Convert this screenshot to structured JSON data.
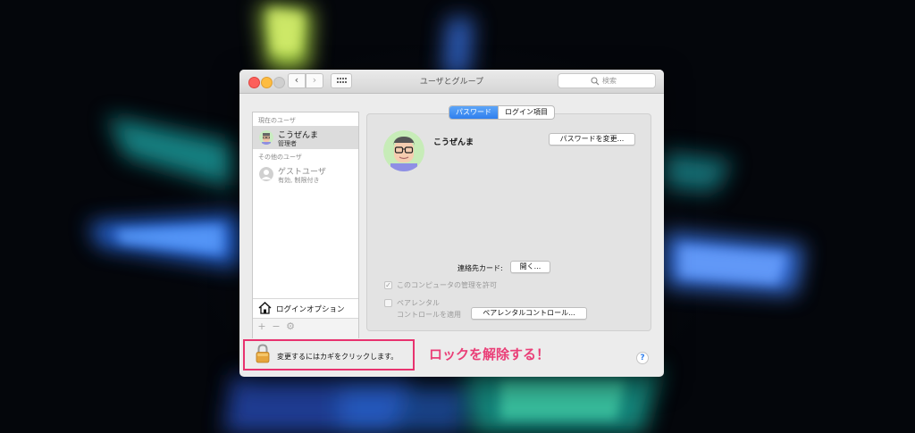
{
  "window": {
    "title": "ユーザとグループ",
    "search_placeholder": "検索",
    "nav_back": "‹",
    "nav_forward": "›"
  },
  "sidebar": {
    "current_users_label": "現在のユーザ",
    "current_user": {
      "name": "こうぜんま",
      "role": "管理者"
    },
    "other_users_label": "その他のユーザ",
    "guest_user": {
      "name": "ゲストユーザ",
      "status": "有効, 制限付き"
    },
    "login_options": "ログインオプション",
    "tools": {
      "add": "+",
      "remove": "−",
      "gear": "⚙"
    }
  },
  "tabs": [
    {
      "label": "パスワード",
      "active": true
    },
    {
      "label": "ログイン項目",
      "active": false
    }
  ],
  "main": {
    "user_name": "こうぜんま",
    "change_password_button": "パスワードを変更...",
    "contact_card_label": "連絡先カード:",
    "open_button": "開く...",
    "allow_admin_label": "このコンピュータの管理を許可",
    "allow_admin_checked": true,
    "parental_line1": "ペアレンタル",
    "parental_line2": "コントロールを適用",
    "parental_checked": false,
    "parental_button": "ペアレンタルコントロール..."
  },
  "footer": {
    "lock_text": "変更するにはカギをクリックします。",
    "help": "?"
  },
  "annotation": {
    "callout": "ロックを解除する！",
    "color": "#e8336f"
  },
  "colors": {
    "accent": "#2f7fee",
    "window_bg": "#ececec"
  }
}
